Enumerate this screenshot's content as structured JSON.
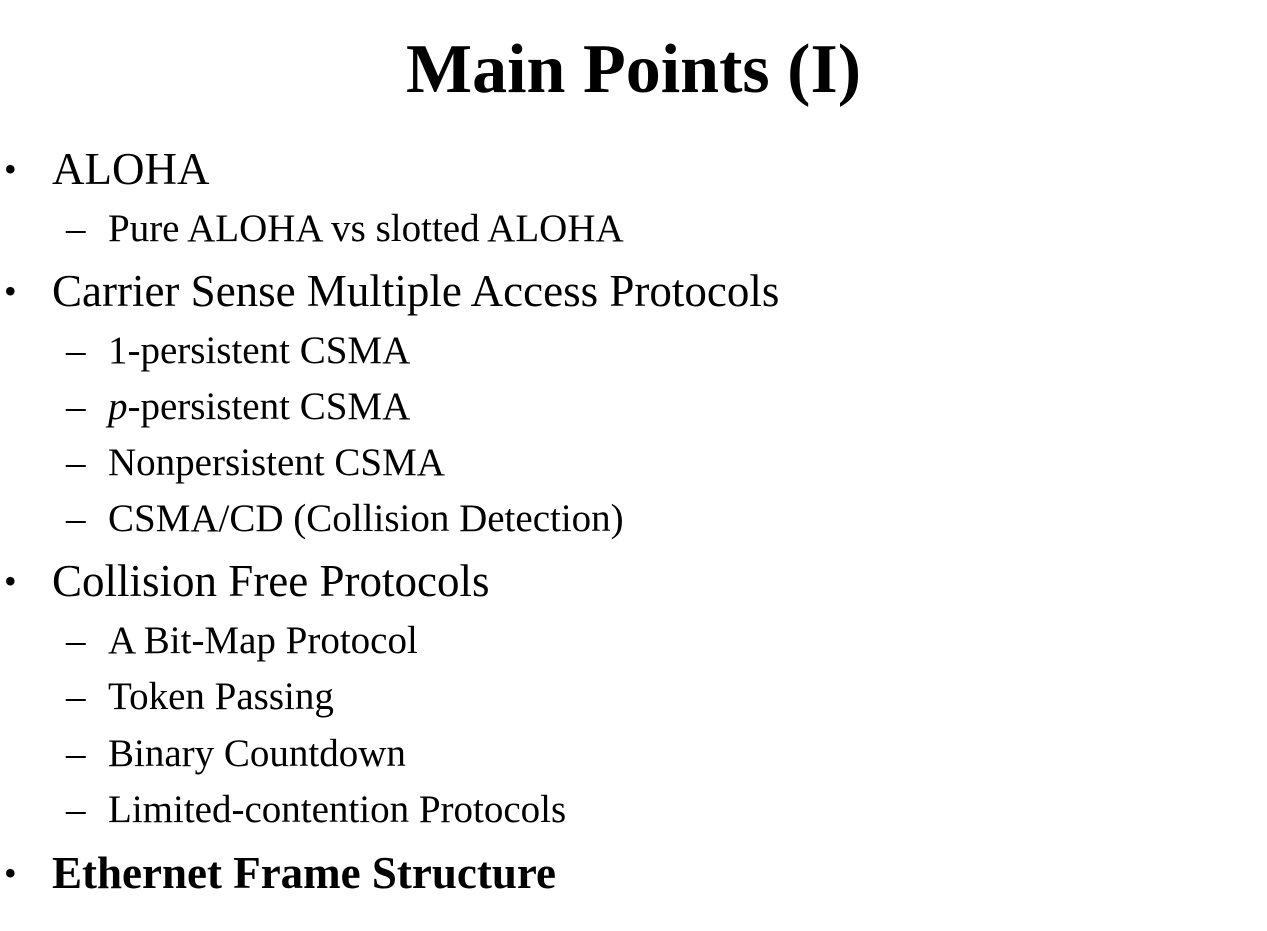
{
  "slide": {
    "title": "Main Points (I)"
  },
  "bullets": {
    "level1_marker": "•",
    "level2_marker": "–"
  },
  "outline": {
    "aloha": {
      "label": "ALOHA",
      "sub": [
        "Pure ALOHA vs slotted ALOHA"
      ]
    },
    "csma": {
      "label": "Carrier Sense Multiple Access Protocols",
      "sub": [
        "1-persistent CSMA",
        "p",
        "-persistent CSMA",
        "Nonpersistent CSMA",
        "CSMA/CD (Collision Detection)"
      ]
    },
    "collision_free": {
      "label": "Collision Free Protocols",
      "sub": [
        "A Bit-Map Protocol",
        "Token Passing",
        "Binary Countdown",
        "Limited-contention Protocols"
      ]
    },
    "ethernet": {
      "label": "Ethernet Frame Structure"
    }
  }
}
